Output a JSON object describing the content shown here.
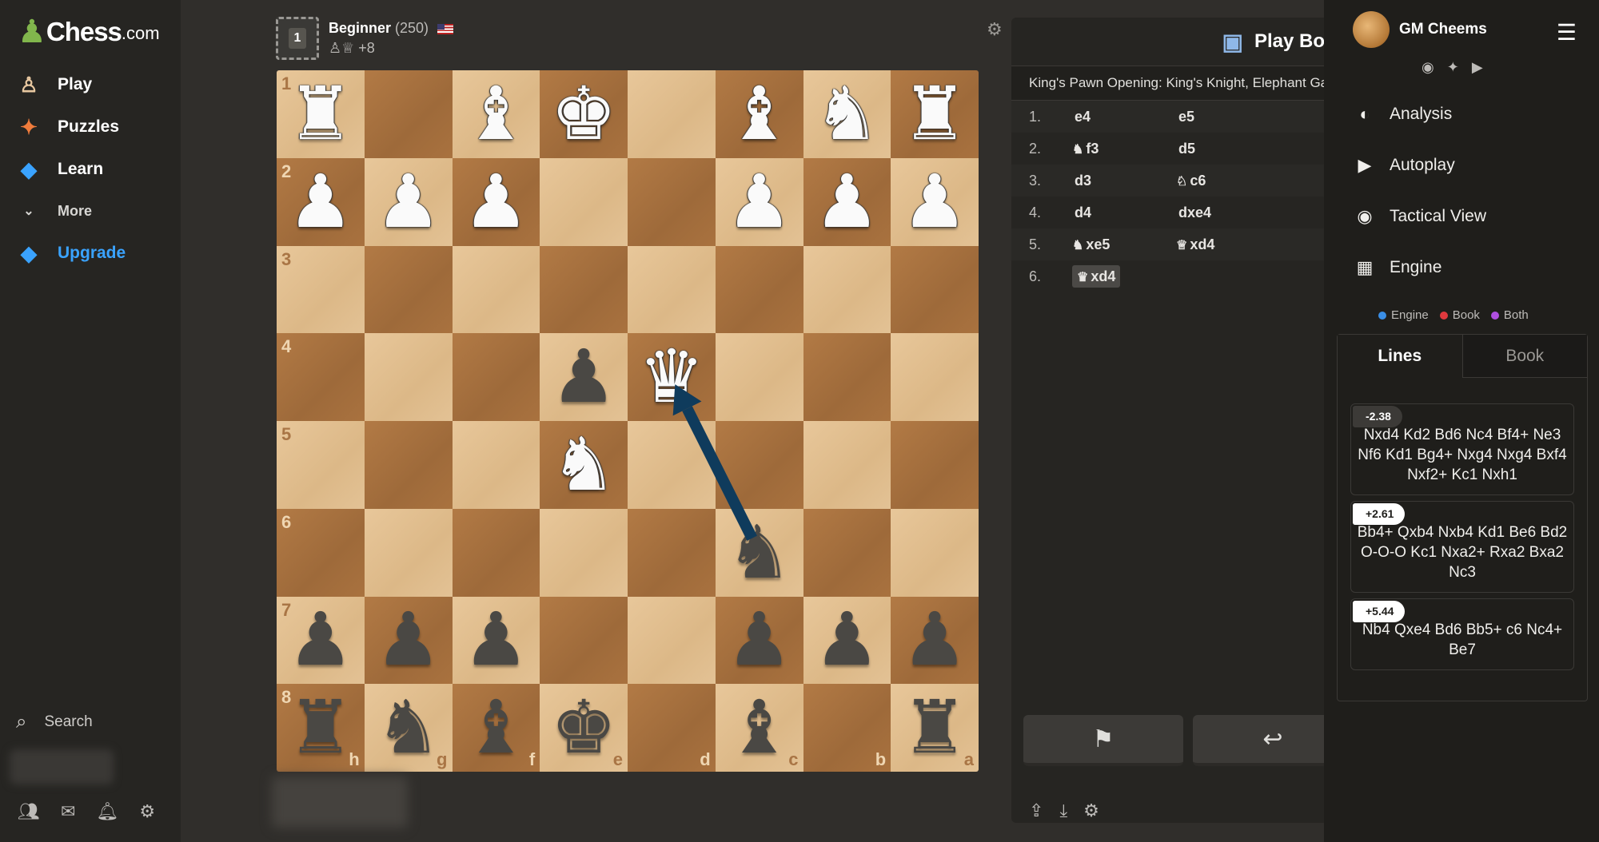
{
  "nav": {
    "logo_word": "Chess",
    "logo_dotcom": ".com",
    "items": [
      {
        "label": "Play",
        "icon": "play-icon"
      },
      {
        "label": "Puzzles",
        "icon": "puzzle-icon"
      },
      {
        "label": "Learn",
        "icon": "learn-icon"
      },
      {
        "label": "More",
        "icon": "chevron-down-icon"
      },
      {
        "label": "Upgrade",
        "icon": "diamond-icon"
      }
    ],
    "search_label": "Search"
  },
  "top_player": {
    "avatar_badge": "1",
    "name": "Beginner",
    "rating": "(250)",
    "material": "+8"
  },
  "board": {
    "orientation": "black",
    "rank_labels": [
      "1",
      "2",
      "3",
      "4",
      "5",
      "6",
      "7",
      "8"
    ],
    "file_labels": [
      "h",
      "g",
      "f",
      "e",
      "d",
      "c",
      "b",
      "a"
    ],
    "rows": [
      [
        "wR",
        "",
        "wB",
        "wK",
        "",
        "wB",
        "wN",
        "wR"
      ],
      [
        "wP",
        "wP",
        "wP",
        "",
        "",
        "wP",
        "wP",
        "wP"
      ],
      [
        "",
        "",
        "",
        "",
        "",
        "",
        "",
        ""
      ],
      [
        "",
        "",
        "",
        "bP",
        "wQ",
        "",
        "",
        ""
      ],
      [
        "",
        "",
        "",
        "wN",
        "",
        "",
        "",
        ""
      ],
      [
        "",
        "",
        "",
        "",
        "",
        "bN",
        "",
        ""
      ],
      [
        "bP",
        "bP",
        "bP",
        "",
        "",
        "bP",
        "bP",
        "bP"
      ],
      [
        "bR",
        "bN",
        "bB",
        "bK",
        "",
        "bB",
        "",
        "bR"
      ]
    ],
    "arrow": {
      "from": "c6",
      "to": "d4",
      "color": "#0f3b5c"
    }
  },
  "moves_panel": {
    "header": "Play Bot",
    "opening": "King's Pawn Opening: King's Knight, Elephant Gambit",
    "moves": [
      {
        "num": "1.",
        "white": "e4",
        "white_fig": "",
        "black": "e5",
        "black_fig": ""
      },
      {
        "num": "2.",
        "white": "f3",
        "white_fig": "♞",
        "black": "d5",
        "black_fig": ""
      },
      {
        "num": "3.",
        "white": "d3",
        "white_fig": "",
        "black": "c6",
        "black_fig": "♘"
      },
      {
        "num": "4.",
        "white": "d4",
        "white_fig": "",
        "black": "dxe4",
        "black_fig": ""
      },
      {
        "num": "5.",
        "white": "xe5",
        "white_fig": "♞",
        "black": "xd4",
        "black_fig": "♕"
      },
      {
        "num": "6.",
        "white": "xd4",
        "white_fig": "♛",
        "black": "",
        "black_fig": ""
      }
    ]
  },
  "right": {
    "username": "GM Cheems",
    "menu_items": [
      "Analysis",
      "Autoplay",
      "Tactical View",
      "Engine"
    ],
    "legend": [
      {
        "label": "Engine",
        "color": "#3a8ee6"
      },
      {
        "label": "Book",
        "color": "#e0393e"
      },
      {
        "label": "Both",
        "color": "#b04fe0"
      }
    ],
    "tabs": [
      "Lines",
      "Book"
    ],
    "lines": [
      {
        "score": "-2.38",
        "moves": "Nxd4 Kd2 Bd6 Nc4 Bf4+ Ne3 Nf6 Kd1 Bg4+ Nxg4 Nxg4 Bxf4 Nxf2+ Kc1 Nxh1"
      },
      {
        "score": "+2.61",
        "moves": "Bb4+ Qxb4 Nxb4 Kd1 Be6 Bd2 O-O-O Kc1 Nxa2+ Rxa2 Bxa2 Nc3"
      },
      {
        "score": "+5.44",
        "moves": "Nb4 Qxe4 Bd6 Bb5+ c6 Nc4+ Be7"
      }
    ]
  }
}
